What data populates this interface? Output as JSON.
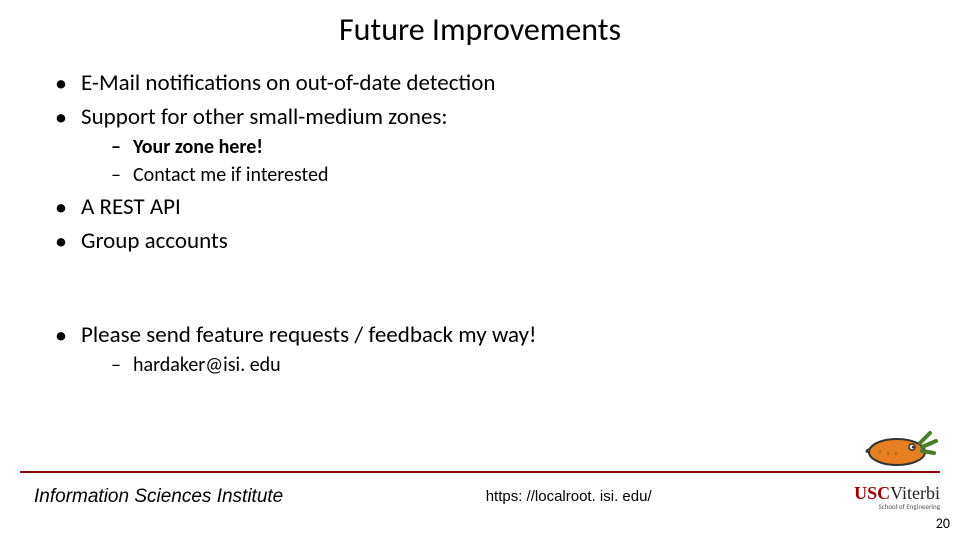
{
  "title": "Future Improvements",
  "bullets": {
    "b1": "E-Mail notifications on out-of-date detection",
    "b2": "Support for other small-medium zones:",
    "b2a": "Your zone here!",
    "b2b": "Contact me if interested",
    "b3": "A REST API",
    "b4": "Group accounts",
    "b5": "Please send feature requests / feedback my way!",
    "b5a": "hardaker@isi. edu"
  },
  "footer": {
    "institute": "Information Sciences Institute",
    "url": "https: //localroot. isi. edu/",
    "logo_usc": "USC",
    "logo_viterbi": "Viterbi",
    "logo_sub": "School of Engineering",
    "page": "20"
  }
}
